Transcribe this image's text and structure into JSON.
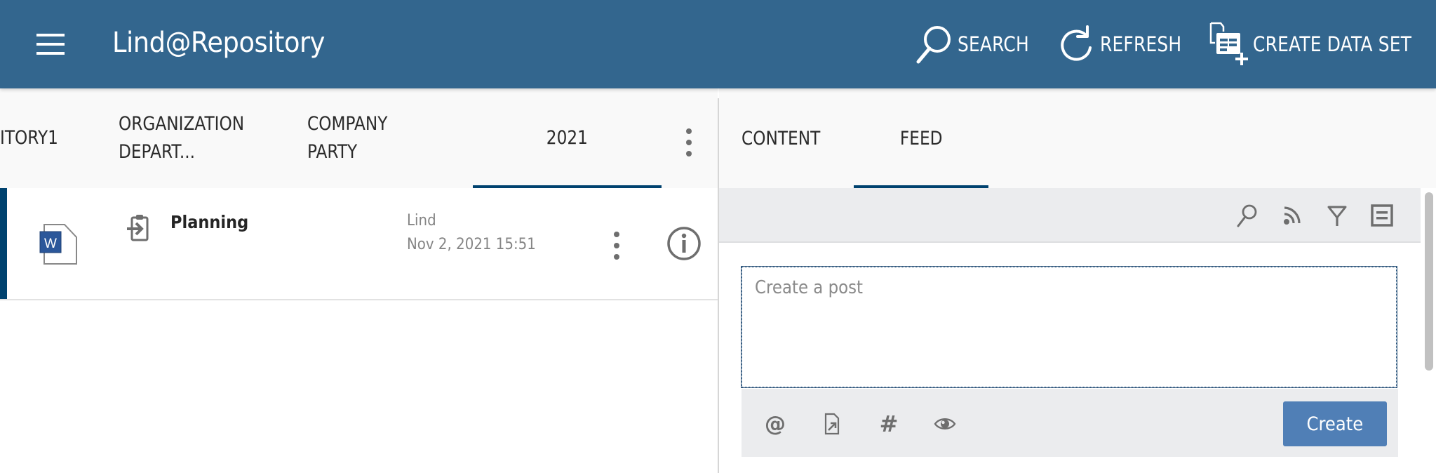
{
  "header": {
    "app_title": "Lind@Repository",
    "actions": [
      {
        "label": "SEARCH",
        "icon": "search-icon"
      },
      {
        "label": "REFRESH",
        "icon": "refresh-icon"
      },
      {
        "label": "CREATE DATA SET",
        "icon": "create-dataset-icon"
      }
    ]
  },
  "left_tabs": {
    "items": [
      {
        "label": "ITORY1",
        "lines": [
          "ITORY1"
        ]
      },
      {
        "label": "ORGANIZATION DEPART...",
        "lines": [
          "ORGANIZATION",
          "DEPART..."
        ]
      },
      {
        "label": "COMPANY PARTY",
        "lines": [
          "COMPANY",
          "PARTY"
        ]
      },
      {
        "label": "2021",
        "lines": [
          "2021"
        ],
        "active": true
      }
    ],
    "more_icon": "kebab-icon"
  },
  "list": {
    "rows": [
      {
        "file_type_icon": "word-document-icon",
        "file_type_letter": "W",
        "status_icon": "checked-in-icon",
        "title": "Planning",
        "author": "Lind",
        "modified": "Nov 2, 2021 15:51",
        "selected": true
      }
    ]
  },
  "right_tabs": {
    "items": [
      {
        "label": "CONTENT"
      },
      {
        "label": "FEED",
        "active": true
      }
    ]
  },
  "feed": {
    "toolbar_icons": [
      "search-icon",
      "rss-icon",
      "filter-icon",
      "list-view-icon"
    ],
    "post": {
      "value": "",
      "placeholder": "Create a post"
    },
    "post_tools": [
      "mention-icon",
      "document-link-icon",
      "hashtag-icon",
      "visibility-icon"
    ],
    "create_label": "Create"
  },
  "colors": {
    "header_bg": "#33668e",
    "accent": "#00426f",
    "button": "#507fb6"
  }
}
